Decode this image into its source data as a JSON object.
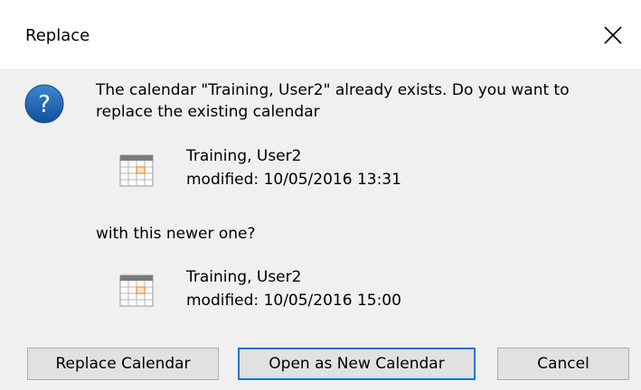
{
  "dialog": {
    "title": "Replace",
    "close_icon": "close-icon",
    "message": "The calendar \"Training, User2\" already exists. Do you want to replace the existing calendar",
    "existing": {
      "name": "Training, User2",
      "modified": "modified: 10/05/2016 13:31"
    },
    "with_text": "with this newer one?",
    "newer": {
      "name": "Training, User2",
      "modified": "modified: 10/05/2016 15:00"
    },
    "buttons": {
      "replace": "Replace Calendar",
      "open_new": "Open as New Calendar",
      "cancel": "Cancel"
    }
  },
  "colors": {
    "background": "#f0f0f0",
    "title_bar": "#ffffff",
    "question_icon": "#1d5fa8",
    "focus_border": "#0078d7",
    "calendar_accent": "#f79646"
  },
  "icons": [
    "close-icon",
    "question-icon",
    "calendar-icon"
  ]
}
